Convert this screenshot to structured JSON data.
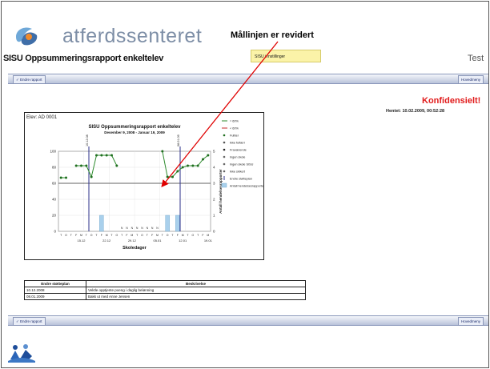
{
  "header": {
    "logo_text": "atferdssenteret",
    "callout": "Mållinjen er revidert",
    "report_title": "SISU Oppsummeringsrapport enkeltelev",
    "filter_chip": "SISU innstillinger",
    "test_label": "Test"
  },
  "toolbar": {
    "left_button": "Endre rapport",
    "right_button": "Hovedmeny"
  },
  "notice": {
    "confidential": "Konfidensielt!",
    "fetched": "Hentet: 10.02.2009, 00:52:28"
  },
  "chart_data": {
    "type": "line",
    "student_label": "Elev: AD 0001",
    "title": "SISU Oppsummeringsrapport enkeltelev",
    "subtitle": "Desember 9, 2008 - Januar 19, 2009",
    "xlabel": "Skoledager",
    "y2label": "Antall hendelsesrapporter",
    "ylim": [
      0,
      100
    ],
    "y_ticks": [
      "0",
      "20",
      "40",
      "60",
      "80",
      "100"
    ],
    "y2_ticks": [
      "0",
      "1",
      "2",
      "3",
      "4",
      "5"
    ],
    "date_ticks": [
      "15.12",
      "22.12",
      "29.12",
      "05.01",
      "12.01",
      "19.01"
    ],
    "day_letters": [
      "T",
      "O",
      "T",
      "F",
      "M",
      "T",
      "O",
      "T",
      "F",
      "M",
      "T",
      "O",
      "T",
      "F",
      "M",
      "T",
      "O",
      "T",
      "F",
      "M",
      "T",
      "O",
      "T",
      "F",
      "M",
      "T",
      "O",
      "T",
      "F",
      "M"
    ],
    "goal_line": 60,
    "legend": [
      "= 60%",
      "< 60%",
      "Fulfær",
      "Ikke fulfærr",
      "Fraværende",
      "Ingen skole",
      "Ingen skole SISU",
      "Ikke skikert",
      "Endre støtteplan",
      "Antall hendelsesrapporter"
    ],
    "phase_labels": [
      "10.12.08",
      "08.01.09"
    ],
    "series": [
      {
        "segment": 1,
        "x": [
          1,
          2
        ],
        "values": [
          67,
          67
        ]
      },
      {
        "segment": 2,
        "x": [
          4,
          5,
          6,
          7,
          8,
          9,
          10,
          11,
          12
        ],
        "values": [
          82,
          82,
          82,
          68,
          95,
          95,
          95,
          95,
          82
        ]
      },
      {
        "segment": 3,
        "x": [
          21,
          22,
          23,
          24,
          25,
          26,
          27,
          28,
          29,
          30
        ],
        "values": [
          100,
          68,
          68,
          75,
          80,
          82,
          82,
          82,
          90,
          95
        ]
      }
    ],
    "events": {
      "x": [
        9,
        22,
        24
      ],
      "values": [
        1,
        1,
        1
      ]
    }
  },
  "plan_table": {
    "headers": [
      "Endre støtteplan",
      "Beskrivelse"
    ],
    "rows": [
      [
        "10.12.2008",
        "Vektle opptjente poeng i daglig belønning"
      ],
      [
        "08.01.2009",
        "Bakk ut med Anne Jensen"
      ]
    ]
  }
}
